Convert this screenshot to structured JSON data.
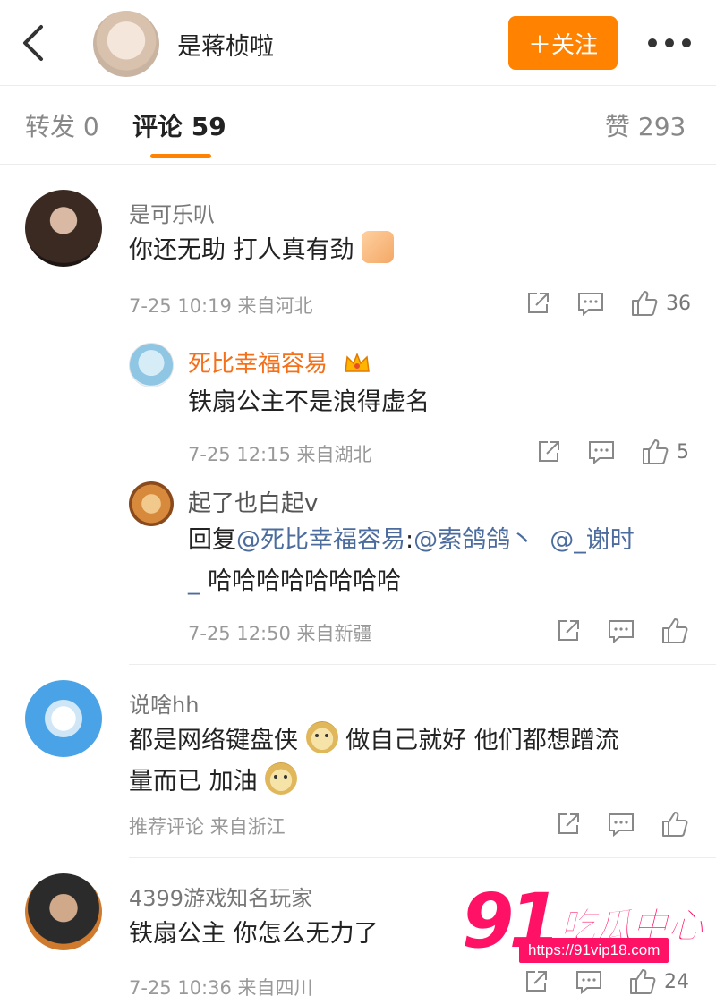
{
  "header": {
    "username": "是蒋桢啦",
    "follow_label": "＋关注"
  },
  "tabs": {
    "repost_label": "转发",
    "repost_count": "0",
    "comment_label": "评论",
    "comment_count": "59",
    "like_label": "赞",
    "like_count": "293"
  },
  "comments": [
    {
      "user": "是可乐叭",
      "text": "你还无助 打人真有劲",
      "time": "7-25 10:19",
      "location": "来自河北",
      "likes": "36"
    },
    {
      "user": "死比幸福容易",
      "text": "铁扇公主不是浪得虚名",
      "time": "7-25 12:15",
      "location": "来自湖北",
      "likes": "5"
    },
    {
      "user": "起了也白起v",
      "reply_prefix": "回复",
      "mention1": "@死比幸福容易",
      "colon": ":",
      "mention2": "@索鸽鸽丶",
      "mention3": "@_谢时",
      "mention3_cont": "_",
      "text_cont": "哈哈哈哈哈哈哈哈",
      "time": "7-25 12:50",
      "location": "来自新疆"
    },
    {
      "user": "说啥hh",
      "text_a": "都是网络键盘侠",
      "text_b": "做自己就好 他们都想蹭流",
      "text_c": "量而已 加油",
      "tag": "推荐评论",
      "location": "来自浙江"
    },
    {
      "user": "4399游戏知名玩家",
      "text": "铁扇公主 你怎么无力了",
      "time": "7-25 10:36",
      "location": "来自四川",
      "likes": "24"
    }
  ],
  "watermark": {
    "brand_number": "91",
    "brand_text": "吃瓜中心",
    "url": "https://91vip18.com"
  },
  "colors": {
    "accent": "#ff8200",
    "mention": "#4c6c9e",
    "vip_name": "#f5701a",
    "watermark": "#ff1166"
  }
}
